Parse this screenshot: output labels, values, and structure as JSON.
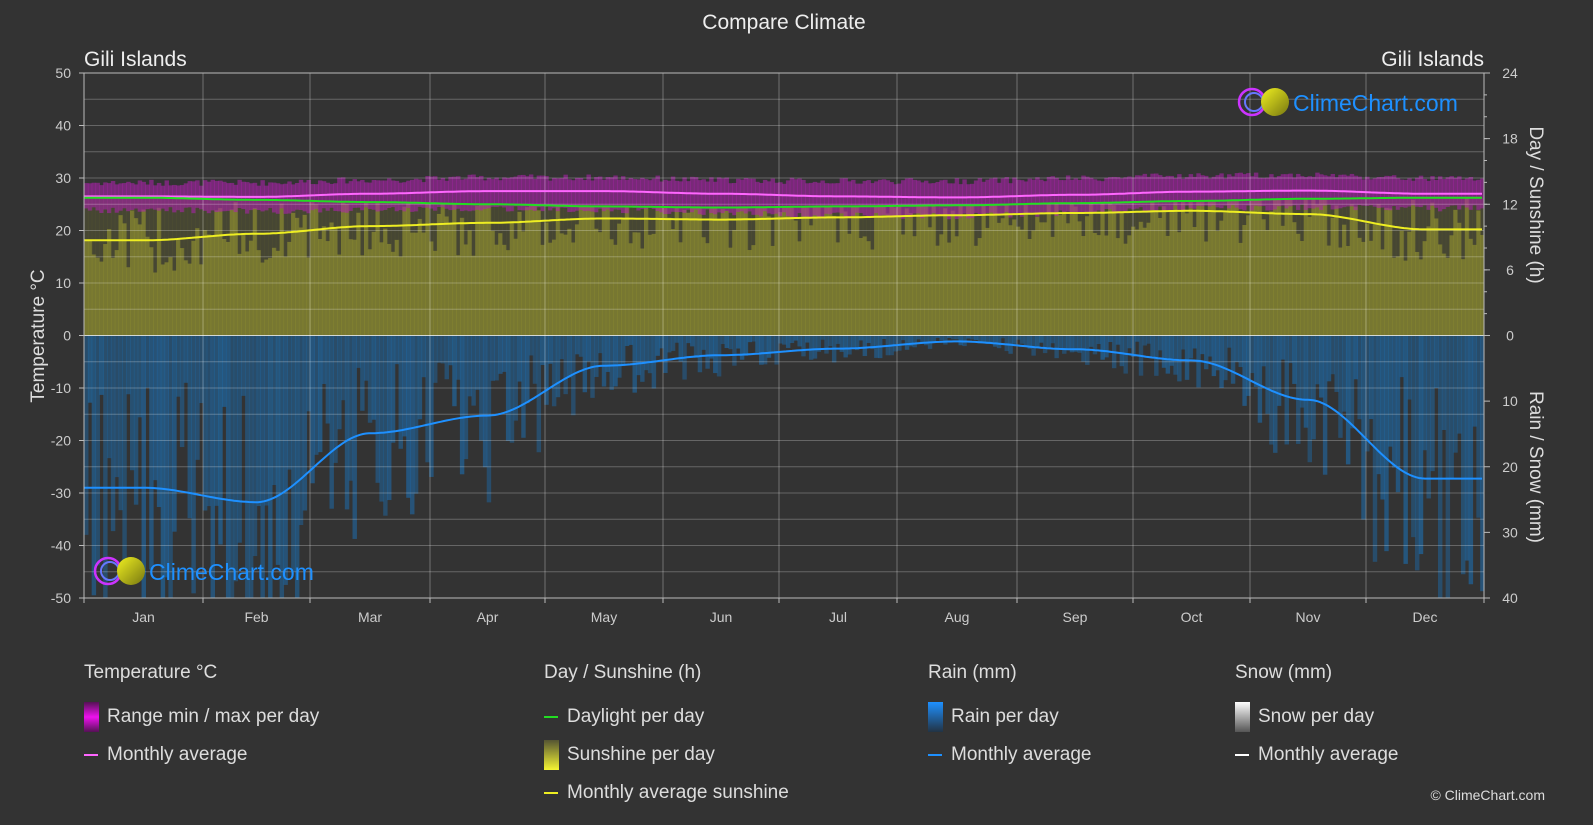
{
  "chart_data": {
    "type": "line",
    "title": "Compare Climate",
    "location_left": "Gili Islands",
    "location_right": "Gili Islands",
    "categories": [
      "Jan",
      "Feb",
      "Mar",
      "Apr",
      "May",
      "Jun",
      "Jul",
      "Aug",
      "Sep",
      "Oct",
      "Nov",
      "Dec"
    ],
    "axes": {
      "left": {
        "label": "Temperature °C",
        "range": [
          -50,
          50
        ],
        "ticks": [
          "50",
          "40",
          "30",
          "20",
          "10",
          "0",
          "-10",
          "-20",
          "-30",
          "-40",
          "-50"
        ]
      },
      "right_top": {
        "label": "Day / Sunshine (h)",
        "range": [
          0,
          24
        ],
        "ticks": [
          "24",
          "18",
          "12",
          "6",
          "0"
        ]
      },
      "right_bottom": {
        "label": "Rain / Snow (mm)",
        "range": [
          0,
          40
        ],
        "ticks": [
          "0",
          "10",
          "20",
          "30",
          "40"
        ]
      }
    },
    "grid": true,
    "series": [
      {
        "name": "Temperature monthly average",
        "unit": "°C",
        "color": "#ff66ff",
        "values": [
          26.5,
          26.4,
          27.0,
          27.5,
          27.5,
          27.0,
          26.5,
          26.3,
          26.8,
          27.4,
          27.6,
          27.0
        ]
      },
      {
        "name": "Temperature range min",
        "unit": "°C",
        "color": "#cc22cc",
        "values": [
          24.5,
          24.3,
          24.5,
          24.8,
          24.5,
          24.0,
          23.5,
          23.3,
          24.0,
          24.8,
          25.0,
          24.8
        ]
      },
      {
        "name": "Temperature range max",
        "unit": "°C",
        "color": "#cc22cc",
        "values": [
          28.5,
          28.5,
          29.0,
          29.5,
          29.5,
          29.0,
          28.8,
          28.8,
          29.3,
          29.8,
          30.0,
          29.3
        ]
      },
      {
        "name": "Daylight per day",
        "unit": "h",
        "color": "#22dd22",
        "values": [
          12.6,
          12.4,
          12.2,
          12.0,
          11.8,
          11.7,
          11.8,
          11.9,
          12.1,
          12.3,
          12.5,
          12.6
        ]
      },
      {
        "name": "Monthly average sunshine",
        "unit": "h",
        "color": "#eeee22",
        "values": [
          8.7,
          9.3,
          10.0,
          10.3,
          10.7,
          10.6,
          10.8,
          11.0,
          11.2,
          11.4,
          11.1,
          9.7
        ]
      },
      {
        "name": "Rain monthly average",
        "unit": "mm",
        "color": "#1e90ff",
        "values": [
          23.2,
          25.4,
          14.9,
          12.2,
          4.6,
          3.0,
          2.0,
          0.9,
          2.1,
          3.8,
          9.8,
          21.8
        ]
      },
      {
        "name": "Snow monthly average",
        "unit": "mm",
        "color": "#ffffff",
        "values": [
          0,
          0,
          0,
          0,
          0,
          0,
          0,
          0,
          0,
          0,
          0,
          0
        ]
      }
    ],
    "legend": {
      "placement": "bottom",
      "groups": [
        {
          "title": "Temperature °C",
          "items": [
            {
              "label": "Range min / max per day",
              "kind": "box",
              "color": "#ee11ee"
            },
            {
              "label": "Monthly average",
              "kind": "line",
              "color": "#ff66ff"
            }
          ]
        },
        {
          "title": "Day / Sunshine (h)",
          "items": [
            {
              "label": "Daylight per day",
              "kind": "line",
              "color": "#22dd22"
            },
            {
              "label": "Sunshine per day",
              "kind": "box",
              "color": "#eeee33"
            },
            {
              "label": "Monthly average sunshine",
              "kind": "line",
              "color": "#eeee22"
            }
          ]
        },
        {
          "title": "Rain (mm)",
          "items": [
            {
              "label": "Rain per day",
              "kind": "box",
              "color": "#1e90ff"
            },
            {
              "label": "Monthly average",
              "kind": "line",
              "color": "#1e90ff"
            }
          ]
        },
        {
          "title": "Snow (mm)",
          "items": [
            {
              "label": "Snow per day",
              "kind": "box",
              "color": "#eeeeee"
            },
            {
              "label": "Monthly average",
              "kind": "line",
              "color": "#ffffff"
            }
          ]
        }
      ]
    }
  },
  "watermark": {
    "text": "ClimeChart.com"
  },
  "copyright": "© ClimeChart.com"
}
